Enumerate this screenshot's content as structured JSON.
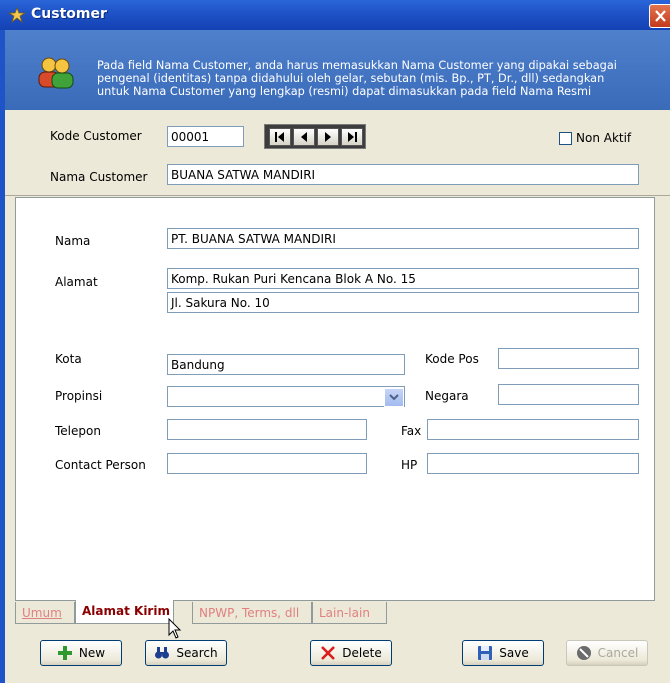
{
  "window": {
    "title": "Customer"
  },
  "banner": {
    "line1": "Pada field Nama Customer, anda harus memasukkan Nama Customer yang dipakai sebagai",
    "line2": "pengenal (identitas) tanpa didahului oleh gelar, sebutan (mis. Bp., PT, Dr., dll) sedangkan",
    "line3": "untuk Nama Customer yang lengkap (resmi) dapat dimasukkan pada field Nama Resmi"
  },
  "header": {
    "kode_customer_label": "Kode Customer",
    "kode_customer_value": "00001",
    "nama_customer_label": "Nama Customer",
    "nama_customer_value": "BUANA SATWA MANDIRI",
    "non_aktif_label": "Non Aktif",
    "non_aktif_checked": false
  },
  "form": {
    "nama_label": "Nama",
    "nama_value": "PT. BUANA SATWA MANDIRI",
    "alamat_label": "Alamat",
    "alamat_line1": "Komp. Rukan Puri Kencana Blok A No. 15",
    "alamat_line2": "Jl. Sakura No. 10",
    "kota_label": "Kota",
    "kota_value": "Bandung",
    "kode_pos_label": "Kode Pos",
    "kode_pos_value": "",
    "propinsi_label": "Propinsi",
    "propinsi_value": "",
    "negara_label": "Negara",
    "negara_value": "",
    "telepon_label": "Telepon",
    "telepon_value": "",
    "fax_label": "Fax",
    "fax_value": "",
    "contact_person_label": "Contact Person",
    "contact_person_value": "",
    "hp_label": "HP",
    "hp_value": ""
  },
  "tabs": [
    {
      "label": "Umum",
      "active": false
    },
    {
      "label": "Alamat Kirim",
      "active": true
    },
    {
      "label": "NPWP, Terms, dll",
      "active": false
    },
    {
      "label": "Lain-lain",
      "active": false
    }
  ],
  "buttons": {
    "new": "New",
    "search": "Search",
    "delete": "Delete",
    "save": "Save",
    "cancel": "Cancel"
  },
  "colors": {
    "title_bar": "#1f54c8",
    "banner": "#4677c6",
    "active_tab_text": "#8a0000",
    "inactive_tab_text": "#e08080"
  }
}
